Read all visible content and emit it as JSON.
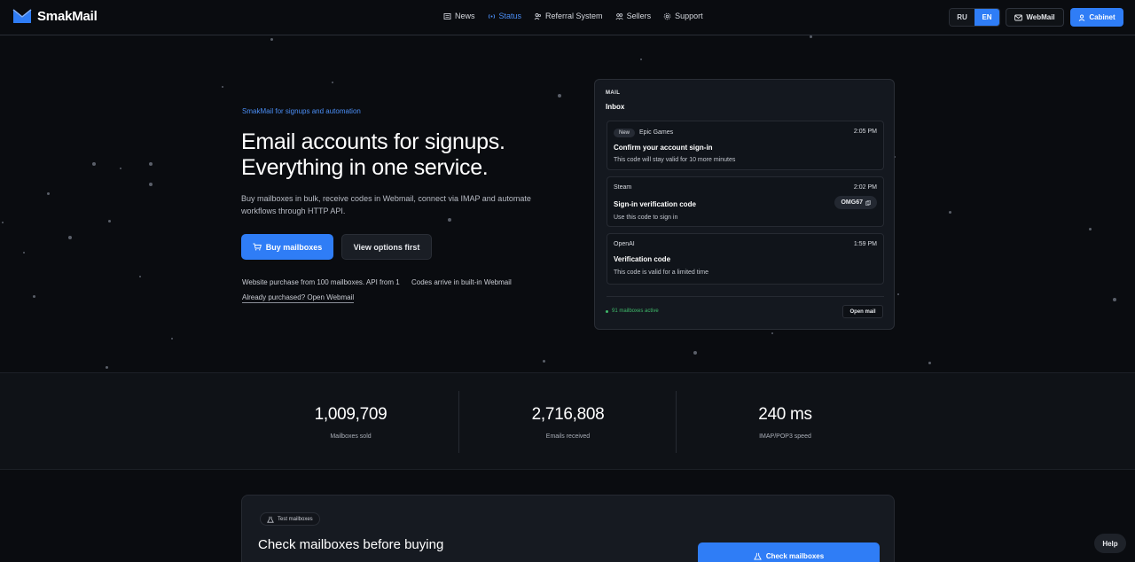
{
  "brand": {
    "name": "SmakMail"
  },
  "nav": [
    {
      "label": "News",
      "icon": "newspaper-icon",
      "active": false
    },
    {
      "label": "Status",
      "icon": "signal-icon",
      "active": true
    },
    {
      "label": "Referral System",
      "icon": "users-icon",
      "active": false
    },
    {
      "label": "Sellers",
      "icon": "group-icon",
      "active": false
    },
    {
      "label": "Support",
      "icon": "gear-icon",
      "active": false
    }
  ],
  "header": {
    "lang_ru": "RU",
    "lang_en": "EN",
    "webmail": "WebMail",
    "cabinet": "Cabinet"
  },
  "hero": {
    "tag": "SmakMail for signups and automation",
    "title_line1": "Email accounts for signups.",
    "title_line2": "Everything in one service.",
    "description": "Buy mailboxes in bulk, receive codes in Webmail, connect via IMAP and automate workflows through HTTP API.",
    "buy_button": "Buy mailboxes",
    "view_button": "View options first",
    "note_purchase": "Website purchase from 100 mailboxes. API from 1",
    "note_codes": "Codes arrive in built-in Webmail",
    "note_webmail_link": "Already purchased? Open Webmail"
  },
  "mail": {
    "label": "MAIL",
    "inbox": "Inbox",
    "messages": [
      {
        "badge": "New",
        "sender": "Epic Games",
        "time": "2:05 PM",
        "subject": "Confirm your account sign-in",
        "body": "This code will stay valid for 10 more minutes"
      },
      {
        "sender": "Steam",
        "time": "2:02 PM",
        "subject": "Sign-in verification code",
        "body": "Use this code to sign in",
        "code": "OMG67"
      },
      {
        "sender": "OpenAI",
        "time": "1:59 PM",
        "subject": "Verification code",
        "body": "This code is valid for a limited time"
      }
    ],
    "active_status": "91 mailboxes active",
    "open_button": "Open mail"
  },
  "stats": [
    {
      "value": "1,009,709",
      "label": "Mailboxes sold"
    },
    {
      "value": "2,716,808",
      "label": "Emails received"
    },
    {
      "value": "240 ms",
      "label": "IMAP/POP3 speed"
    }
  ],
  "test": {
    "tag": "Test mailboxes",
    "title": "Check mailboxes before buying",
    "button": "Check mailboxes"
  },
  "help": "Help",
  "colors": {
    "accent": "#2f7df6",
    "background": "#0a0c10",
    "active_green": "#3fb96a"
  }
}
